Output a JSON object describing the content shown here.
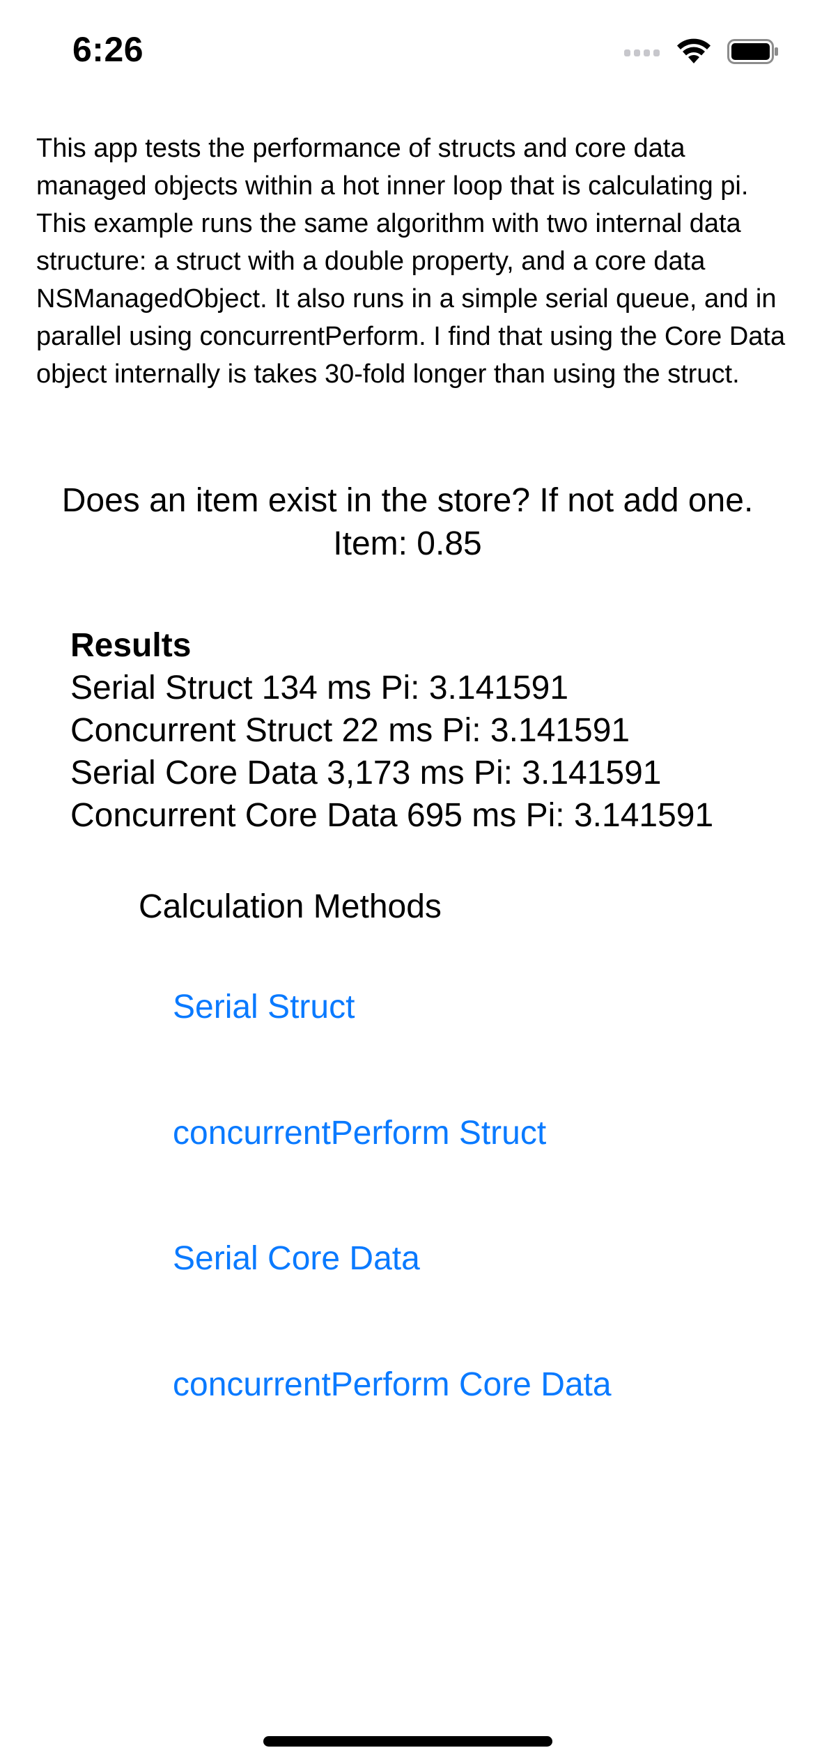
{
  "status_bar": {
    "time": "6:26",
    "icons": [
      "cellular-signal-icon",
      "wifi-icon",
      "battery-icon"
    ]
  },
  "intro": {
    "text": "This app tests the performance of structs and core data managed objects within a hot inner loop that is calculating pi. This example runs the same algorithm with two internal data structure: a struct with a double property, and a core data NSManagedObject. It also runs in a simple serial queue, and in parallel using concurrentPerform. I find that using the Core Data object internally is takes 30-fold longer than using the struct."
  },
  "store": {
    "question": "Does an item exist in the store? If not add one.",
    "item": "Item: 0.85"
  },
  "results": {
    "title": "Results",
    "rows": [
      "Serial Struct 134 ms Pi: 3.141591",
      "Concurrent Struct 22 ms Pi: 3.141591",
      "Serial Core Data 3,173 ms Pi: 3.141591",
      "Concurrent Core Data 695 ms Pi: 3.141591"
    ]
  },
  "methods": {
    "title": "Calculation Methods",
    "buttons": [
      "Serial Struct",
      "concurrentPerform Struct",
      "Serial Core Data",
      "concurrentPerform Core Data"
    ]
  },
  "colors": {
    "accent": "#0a7aff",
    "text": "#000000",
    "background": "#ffffff"
  }
}
